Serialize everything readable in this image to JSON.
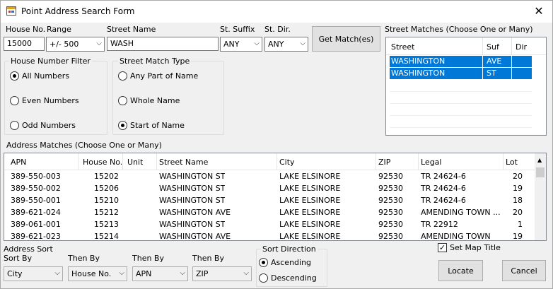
{
  "window": {
    "title": "Point Address Search Form",
    "close_glyph": "✕"
  },
  "search": {
    "house_no_label": "House No.",
    "house_no_value": "15000",
    "range_label": "Range",
    "range_value": "+/- 500",
    "street_name_label": "Street Name",
    "street_name_value": "WASH",
    "st_suffix_label": "St. Suffix",
    "st_suffix_value": "ANY",
    "st_dir_label": "St. Dir.",
    "st_dir_value": "ANY",
    "get_matches_label": "Get Match(es)"
  },
  "house_filter": {
    "title": "House Number Filter",
    "options": [
      {
        "label": "All Numbers",
        "selected": true
      },
      {
        "label": "Even Numbers",
        "selected": false
      },
      {
        "label": "Odd Numbers",
        "selected": false
      }
    ]
  },
  "street_match_type": {
    "title": "Street Match Type",
    "options": [
      {
        "label": "Any Part of Name",
        "selected": false
      },
      {
        "label": "Whole Name",
        "selected": false
      },
      {
        "label": "Start of Name",
        "selected": true
      }
    ]
  },
  "street_matches": {
    "title": "Street Matches (Choose One or Many)",
    "columns": [
      "Street",
      "Suf",
      "Dir"
    ],
    "rows": [
      {
        "street": "WASHINGTON",
        "suf": "AVE",
        "dir": "",
        "selected": true
      },
      {
        "street": "WASHINGTON",
        "suf": "ST",
        "dir": "",
        "selected": true
      }
    ]
  },
  "address_matches": {
    "title": "Address Matches (Choose One or Many)",
    "columns": [
      "APN",
      "House No.",
      "Unit",
      "Street Name",
      "City",
      "ZIP",
      "Legal",
      "Lot"
    ],
    "rows": [
      [
        "389-550-003",
        "15202",
        "",
        "WASHINGTON ST",
        "LAKE ELSINORE",
        "92530",
        "TR 24624-6",
        "20"
      ],
      [
        "389-550-002",
        "15206",
        "",
        "WASHINGTON ST",
        "LAKE ELSINORE",
        "92530",
        "TR 24624-6",
        "19"
      ],
      [
        "389-550-001",
        "15210",
        "",
        "WASHINGTON ST",
        "LAKE ELSINORE",
        "92530",
        "TR 24624-6",
        "18"
      ],
      [
        "389-621-024",
        "15212",
        "",
        "WASHINGTON AVE",
        "LAKE ELSINORE",
        "92530",
        "AMENDING TOWN ...",
        "20"
      ],
      [
        "389-061-001",
        "15213",
        "",
        "WASHINGTON ST",
        "LAKE ELSINORE",
        "92530",
        "TR 22912",
        "1"
      ],
      [
        "389-621-023",
        "15214",
        "",
        "WASHINGTON AVE",
        "LAKE ELSINORE",
        "92530",
        "AMENDING TOWN",
        "19"
      ]
    ]
  },
  "sort": {
    "address_sort_label": "Address Sort",
    "sort_by_label": "Sort By",
    "sort_by_value": "City",
    "then_by_1_label": "Then By",
    "then_by_1_value": "House No.",
    "then_by_2_label": "Then By",
    "then_by_2_value": "APN",
    "then_by_3_label": "Then By",
    "then_by_3_value": "ZIP",
    "direction_title": "Sort Direction",
    "ascending_label": "Ascending",
    "descending_label": "Descending",
    "ascending_selected": true
  },
  "actions": {
    "set_map_title_label": "Set Map Title",
    "set_map_title_checked": true,
    "check_glyph": "✓",
    "locate_label": "Locate",
    "cancel_label": "Cancel"
  },
  "icons": {
    "app": "form-icon",
    "close": "close-icon",
    "dropdown": "chevron-down-icon"
  },
  "colors": {
    "selection": "#0078d7",
    "window_bg": "#f0f0f0"
  }
}
